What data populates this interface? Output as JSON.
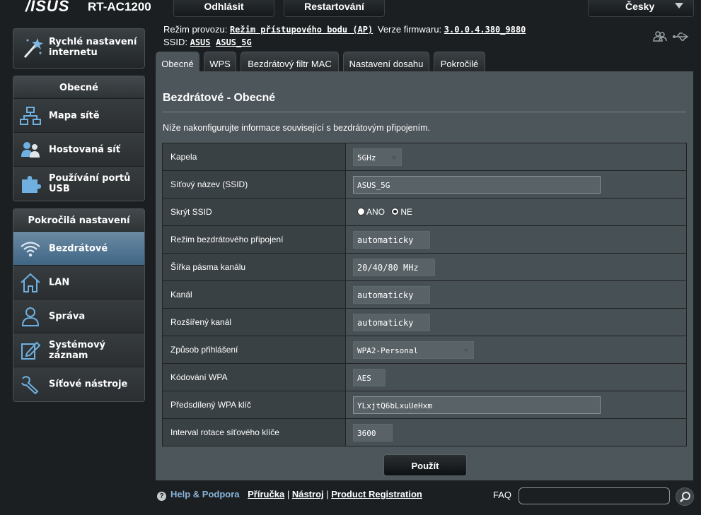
{
  "header": {
    "logo": "/ISUS",
    "model": "RT-AC1200",
    "logout_label": "Odhlásit",
    "restart_label": "Restartování",
    "language": "Česky"
  },
  "sidebar": {
    "quick_setup_label": "Rychlé nastavení internetu",
    "general_title": "Obecné",
    "general_items": [
      {
        "label": "Mapa sítě",
        "icon": "network-map-icon"
      },
      {
        "label": "Hostovaná síť",
        "icon": "guest-network-icon"
      },
      {
        "label": "Používání portů USB",
        "icon": "usb-puzzle-icon"
      }
    ],
    "advanced_title": "Pokročilá nastavení",
    "advanced_items": [
      {
        "label": "Bezdrátové",
        "icon": "wifi-icon",
        "active": true
      },
      {
        "label": "LAN",
        "icon": "home-icon"
      },
      {
        "label": "Správa",
        "icon": "admin-user-icon"
      },
      {
        "label": "Systémový záznam",
        "icon": "system-log-icon"
      },
      {
        "label": "Síťové nástroje",
        "icon": "network-tools-icon"
      }
    ]
  },
  "status": {
    "mode_label": "Režim provozu:",
    "mode_value": "Režim přístupového bodu (AP)",
    "firmware_label": "Verze firmwaru:",
    "firmware_value": "3.0.0.4.380_9880",
    "ssid_label": "SSID:",
    "ssid_values": [
      "ASUS",
      "ASUS_5G"
    ]
  },
  "tabs": [
    "Obecné",
    "WPS",
    "Bezdrátový filtr MAC",
    "Nastavení dosahu",
    "Pokročilé"
  ],
  "panel": {
    "title": "Bezdrátové - Obecné",
    "description": "Níže nakonfigurujte informace související s bezdrátovým připojením.",
    "rows": {
      "band": {
        "label": "Kapela",
        "value": "5GHz"
      },
      "ssid": {
        "label": "Síťový název (SSID)",
        "value": "ASUS_5G"
      },
      "hide_ssid": {
        "label": "Skrýt SSID",
        "yes": "ANO",
        "no": "NE",
        "selected": "NE"
      },
      "wireless_mode": {
        "label": "Režim bezdrátového připojení",
        "value": "automaticky"
      },
      "bandwidth": {
        "label": "Šířka pásma kanálu",
        "value": "20/40/80 MHz"
      },
      "channel": {
        "label": "Kanál",
        "value": "automaticky"
      },
      "ext_channel": {
        "label": "Rozšířený kanál",
        "value": "automaticky"
      },
      "auth": {
        "label": "Způsob přihlášení",
        "value": "WPA2-Personal"
      },
      "wpa_enc": {
        "label": "Kódování WPA",
        "value": "AES"
      },
      "psk": {
        "label": "Předsdílený WPA klíč",
        "value": "YLxjtQ6bLxuUeHxm"
      },
      "key_interval": {
        "label": "Interval rotace síťového klíče",
        "value": "3600"
      }
    },
    "apply_label": "Použít"
  },
  "footer": {
    "help_label": "Help & Podpora",
    "manual": "Příručka",
    "utility": "Nástroj",
    "registration": "Product Registration",
    "sep": "|",
    "faq_label": "FAQ"
  }
}
